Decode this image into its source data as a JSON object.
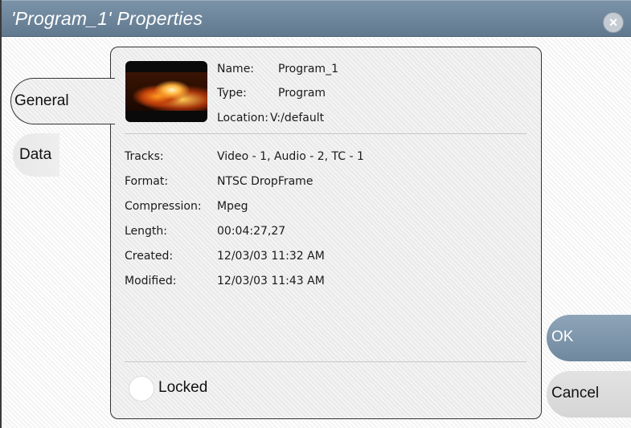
{
  "window": {
    "title": "'Program_1' Properties",
    "close_icon": "×"
  },
  "tabs": [
    {
      "label": "General",
      "selected": true
    },
    {
      "label": "Data",
      "selected": false
    }
  ],
  "clip": {
    "thumbnail_icon": "fire-thumbnail",
    "header_fields": [
      {
        "label": "Name:",
        "value": "Program_1"
      },
      {
        "label": "Type:",
        "value": "Program"
      },
      {
        "label": "Location:",
        "value": "V:/default"
      }
    ],
    "detail_fields": [
      {
        "label": "Tracks:",
        "value": "Video - 1, Audio - 2, TC - 1"
      },
      {
        "label": "Format:",
        "value": "NTSC DropFrame"
      },
      {
        "label": "Compression:",
        "value": "Mpeg"
      },
      {
        "label": "Length:",
        "value": "00:04:27,27"
      },
      {
        "label": "Created:",
        "value": "12/03/03 11:32 AM"
      },
      {
        "label": "Modified:",
        "value": "12/03/03 11:43 AM"
      }
    ],
    "locked_label": "Locked",
    "locked": false
  },
  "buttons": {
    "ok_label": "OK",
    "cancel_label": "Cancel"
  },
  "colors": {
    "titlebar": "#6e869c",
    "ok_button": "#7d95ab",
    "cancel_button": "#dcdcdc"
  }
}
